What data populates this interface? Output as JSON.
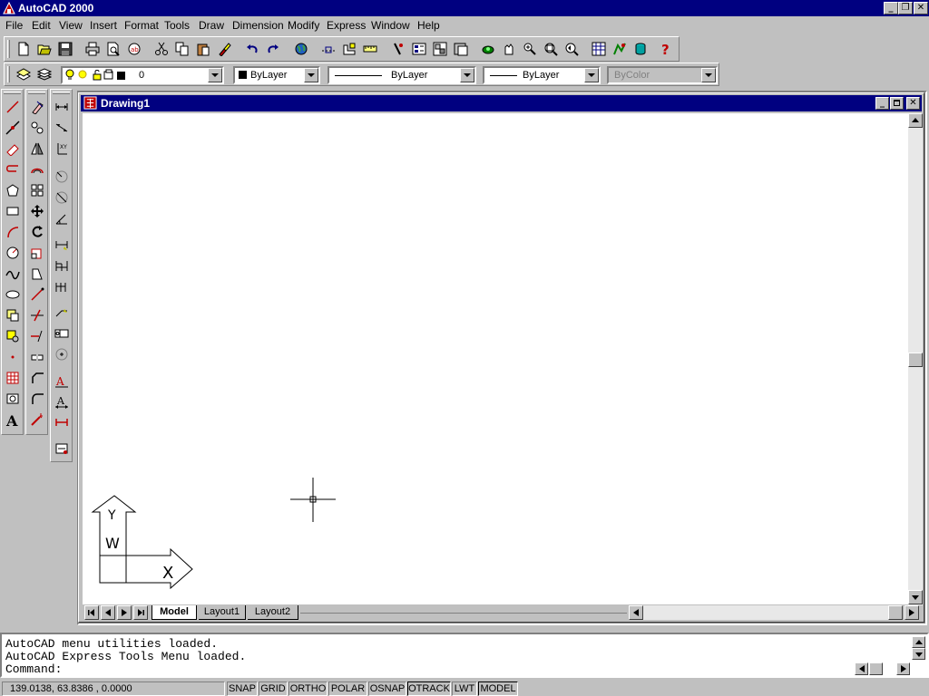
{
  "app": {
    "title": "AutoCAD 2000",
    "caption_buttons": {
      "minimize": "_",
      "restore": "❐",
      "close": "✕"
    }
  },
  "menu": {
    "items": [
      "File",
      "Edit",
      "View",
      "Insert",
      "Format",
      "Tools",
      "Draw",
      "Dimension",
      "Modify",
      "Express",
      "Window",
      "Help"
    ]
  },
  "properties": {
    "layer": "0",
    "color": "ByLayer",
    "linetype": "ByLayer",
    "lineweight": "ByLayer",
    "plotstyle": "ByColor"
  },
  "drawing": {
    "title": "Drawing1",
    "ucs": {
      "y_label": "Y",
      "w_label": "W",
      "x_label": "X"
    },
    "tabs": [
      "Model",
      "Layout1",
      "Layout2"
    ],
    "active_tab": "Model"
  },
  "command": {
    "history": [
      "AutoCAD menu utilities loaded.",
      "AutoCAD Express Tools Menu loaded."
    ],
    "prompt": "Command:"
  },
  "status": {
    "coordinates": "139.0138, 63.8386 , 0.0000",
    "toggles": [
      {
        "label": "SNAP",
        "on": false
      },
      {
        "label": "GRID",
        "on": false
      },
      {
        "label": "ORTHO",
        "on": false
      },
      {
        "label": "POLAR",
        "on": false
      },
      {
        "label": "OSNAP",
        "on": false
      },
      {
        "label": "OTRACK",
        "on": true
      },
      {
        "label": "LWT",
        "on": false
      },
      {
        "label": "MODEL",
        "on": true
      }
    ]
  },
  "colors": {
    "title_bar": "#000080",
    "face": "#c0c0c0",
    "canvas": "#ffffff",
    "help_icon": "#c00000"
  }
}
